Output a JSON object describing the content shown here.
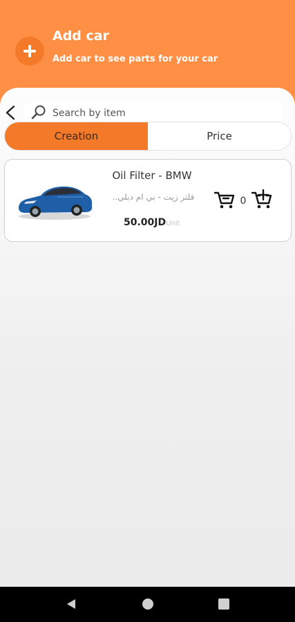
{
  "header": {
    "title": "Add car",
    "subtitle": "Add car to see parts for your car",
    "add_icon": "plus-icon",
    "accent": "#fe8f45",
    "button_color": "#f47a2a"
  },
  "search": {
    "placeholder": "Search by item",
    "back_icon": "chevron-left-icon",
    "icon": "search-icon"
  },
  "sort_tabs": [
    {
      "label": "Creation",
      "active": true
    },
    {
      "label": "Price",
      "active": false
    }
  ],
  "products": [
    {
      "name": "Oil Filter - BMW",
      "name_ar": "فلتر زيت - بي ام دبلي..",
      "price": "50.00JD",
      "unit": "Unit",
      "quantity": "0",
      "image": "car-image",
      "remove_icon": "cart-remove-icon",
      "add_icon": "cart-add-icon"
    }
  ],
  "system_nav": {
    "back_icon": "nav-back-icon",
    "home_icon": "nav-home-icon",
    "recents_icon": "nav-recents-icon"
  }
}
